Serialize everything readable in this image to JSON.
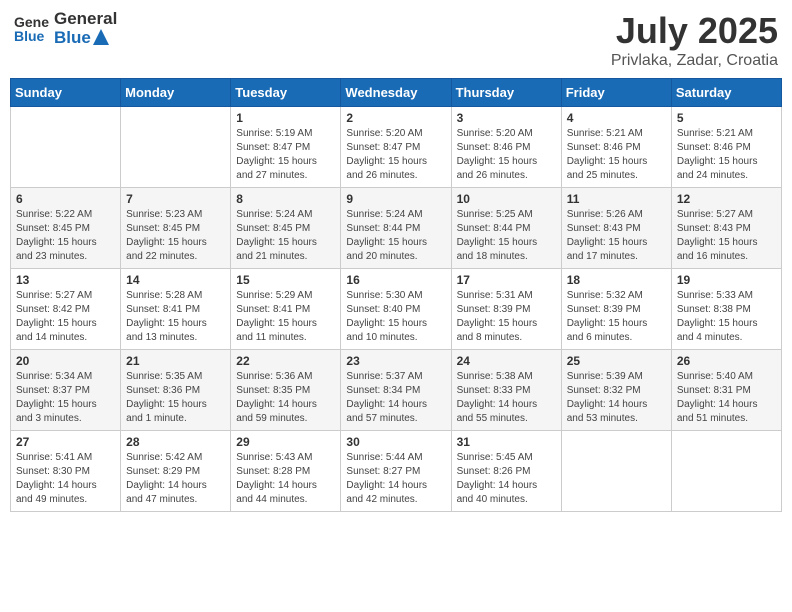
{
  "header": {
    "logo_general": "General",
    "logo_blue": "Blue",
    "month": "July 2025",
    "location": "Privlaka, Zadar, Croatia"
  },
  "weekdays": [
    "Sunday",
    "Monday",
    "Tuesday",
    "Wednesday",
    "Thursday",
    "Friday",
    "Saturday"
  ],
  "weeks": [
    [
      {
        "day": "",
        "info": ""
      },
      {
        "day": "",
        "info": ""
      },
      {
        "day": "1",
        "info": "Sunrise: 5:19 AM\nSunset: 8:47 PM\nDaylight: 15 hours and 27 minutes."
      },
      {
        "day": "2",
        "info": "Sunrise: 5:20 AM\nSunset: 8:47 PM\nDaylight: 15 hours and 26 minutes."
      },
      {
        "day": "3",
        "info": "Sunrise: 5:20 AM\nSunset: 8:46 PM\nDaylight: 15 hours and 26 minutes."
      },
      {
        "day": "4",
        "info": "Sunrise: 5:21 AM\nSunset: 8:46 PM\nDaylight: 15 hours and 25 minutes."
      },
      {
        "day": "5",
        "info": "Sunrise: 5:21 AM\nSunset: 8:46 PM\nDaylight: 15 hours and 24 minutes."
      }
    ],
    [
      {
        "day": "6",
        "info": "Sunrise: 5:22 AM\nSunset: 8:45 PM\nDaylight: 15 hours and 23 minutes."
      },
      {
        "day": "7",
        "info": "Sunrise: 5:23 AM\nSunset: 8:45 PM\nDaylight: 15 hours and 22 minutes."
      },
      {
        "day": "8",
        "info": "Sunrise: 5:24 AM\nSunset: 8:45 PM\nDaylight: 15 hours and 21 minutes."
      },
      {
        "day": "9",
        "info": "Sunrise: 5:24 AM\nSunset: 8:44 PM\nDaylight: 15 hours and 20 minutes."
      },
      {
        "day": "10",
        "info": "Sunrise: 5:25 AM\nSunset: 8:44 PM\nDaylight: 15 hours and 18 minutes."
      },
      {
        "day": "11",
        "info": "Sunrise: 5:26 AM\nSunset: 8:43 PM\nDaylight: 15 hours and 17 minutes."
      },
      {
        "day": "12",
        "info": "Sunrise: 5:27 AM\nSunset: 8:43 PM\nDaylight: 15 hours and 16 minutes."
      }
    ],
    [
      {
        "day": "13",
        "info": "Sunrise: 5:27 AM\nSunset: 8:42 PM\nDaylight: 15 hours and 14 minutes."
      },
      {
        "day": "14",
        "info": "Sunrise: 5:28 AM\nSunset: 8:41 PM\nDaylight: 15 hours and 13 minutes."
      },
      {
        "day": "15",
        "info": "Sunrise: 5:29 AM\nSunset: 8:41 PM\nDaylight: 15 hours and 11 minutes."
      },
      {
        "day": "16",
        "info": "Sunrise: 5:30 AM\nSunset: 8:40 PM\nDaylight: 15 hours and 10 minutes."
      },
      {
        "day": "17",
        "info": "Sunrise: 5:31 AM\nSunset: 8:39 PM\nDaylight: 15 hours and 8 minutes."
      },
      {
        "day": "18",
        "info": "Sunrise: 5:32 AM\nSunset: 8:39 PM\nDaylight: 15 hours and 6 minutes."
      },
      {
        "day": "19",
        "info": "Sunrise: 5:33 AM\nSunset: 8:38 PM\nDaylight: 15 hours and 4 minutes."
      }
    ],
    [
      {
        "day": "20",
        "info": "Sunrise: 5:34 AM\nSunset: 8:37 PM\nDaylight: 15 hours and 3 minutes."
      },
      {
        "day": "21",
        "info": "Sunrise: 5:35 AM\nSunset: 8:36 PM\nDaylight: 15 hours and 1 minute."
      },
      {
        "day": "22",
        "info": "Sunrise: 5:36 AM\nSunset: 8:35 PM\nDaylight: 14 hours and 59 minutes."
      },
      {
        "day": "23",
        "info": "Sunrise: 5:37 AM\nSunset: 8:34 PM\nDaylight: 14 hours and 57 minutes."
      },
      {
        "day": "24",
        "info": "Sunrise: 5:38 AM\nSunset: 8:33 PM\nDaylight: 14 hours and 55 minutes."
      },
      {
        "day": "25",
        "info": "Sunrise: 5:39 AM\nSunset: 8:32 PM\nDaylight: 14 hours and 53 minutes."
      },
      {
        "day": "26",
        "info": "Sunrise: 5:40 AM\nSunset: 8:31 PM\nDaylight: 14 hours and 51 minutes."
      }
    ],
    [
      {
        "day": "27",
        "info": "Sunrise: 5:41 AM\nSunset: 8:30 PM\nDaylight: 14 hours and 49 minutes."
      },
      {
        "day": "28",
        "info": "Sunrise: 5:42 AM\nSunset: 8:29 PM\nDaylight: 14 hours and 47 minutes."
      },
      {
        "day": "29",
        "info": "Sunrise: 5:43 AM\nSunset: 8:28 PM\nDaylight: 14 hours and 44 minutes."
      },
      {
        "day": "30",
        "info": "Sunrise: 5:44 AM\nSunset: 8:27 PM\nDaylight: 14 hours and 42 minutes."
      },
      {
        "day": "31",
        "info": "Sunrise: 5:45 AM\nSunset: 8:26 PM\nDaylight: 14 hours and 40 minutes."
      },
      {
        "day": "",
        "info": ""
      },
      {
        "day": "",
        "info": ""
      }
    ]
  ]
}
